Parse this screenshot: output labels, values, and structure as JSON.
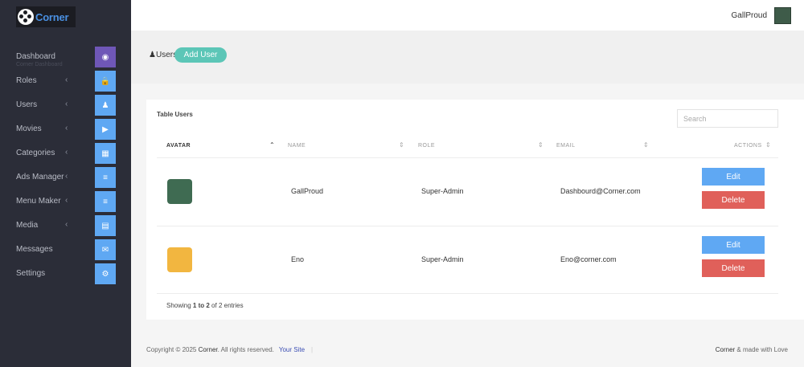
{
  "app": {
    "name": "Corner"
  },
  "sidebar": {
    "items": [
      {
        "label": "Dashboard",
        "sub": "Corner Dashboard",
        "icon": "target-icon",
        "arrow": "",
        "glyph": "◉",
        "active": true
      },
      {
        "label": "Roles",
        "sub": "",
        "icon": "lock-icon",
        "arrow": "‹",
        "glyph": "🔒"
      },
      {
        "label": "Users",
        "sub": "",
        "icon": "person-icon",
        "arrow": "‹",
        "glyph": "♟"
      },
      {
        "label": "Movies",
        "sub": "",
        "icon": "youtube-icon",
        "arrow": "‹",
        "glyph": "▶"
      },
      {
        "label": "Categories",
        "sub": "",
        "icon": "image-icon",
        "arrow": "‹",
        "glyph": "▦"
      },
      {
        "label": "Ads Manager",
        "sub": "",
        "icon": "list-icon",
        "arrow": "‹",
        "glyph": "≡"
      },
      {
        "label": "Menu Maker",
        "sub": "",
        "icon": "menu-icon",
        "arrow": "‹",
        "glyph": "≡"
      },
      {
        "label": "Media",
        "sub": "",
        "icon": "folder-icon",
        "arrow": "‹",
        "glyph": "▤"
      },
      {
        "label": "Messages",
        "sub": "",
        "icon": "inbox-icon",
        "arrow": "",
        "glyph": "✉"
      },
      {
        "label": "Settings",
        "sub": "",
        "icon": "gear-icon",
        "arrow": "",
        "glyph": "⚙"
      }
    ]
  },
  "topbar": {
    "username": "GallProud"
  },
  "header": {
    "crumb": "Users",
    "add_user_label": "Add User"
  },
  "table": {
    "title": "Table Users",
    "search_placeholder": "Search",
    "columns": [
      "AVATAR",
      "NAME",
      "ROLE",
      "EMAIL",
      "ACTIONS"
    ],
    "rows": [
      {
        "name": "GallProud",
        "role": "Super-Admin",
        "email": "Dashbourd@Corner.com",
        "avatar_color": "#3f6b52"
      },
      {
        "name": "Eno",
        "role": "Super-Admin",
        "email": "Eno@corner.com",
        "avatar_color": "#f2b640"
      }
    ],
    "edit_label": "Edit",
    "delete_label": "Delete",
    "showing": {
      "prefix": "Showing ",
      "range": "1 to 2",
      "suffix": " of 2 entries"
    }
  },
  "footer": {
    "copyright": "Copyright © 2025 ",
    "brand": "Corner",
    "rights": ". All rights reserved.",
    "link": "Your Site",
    "sep": "|",
    "made_brand": "Corner",
    "made_suffix": " & made with Love"
  },
  "colors": {
    "sidebar": "#2b2d38",
    "accent": "#5fa8f3",
    "active": "#6f57b7",
    "add_user": "#5cc6b7",
    "delete": "#e0605a"
  }
}
